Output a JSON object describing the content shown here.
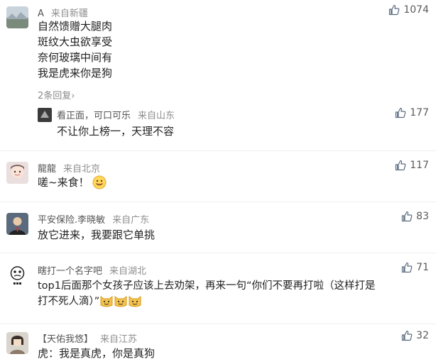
{
  "comments": [
    {
      "user": "A",
      "location": "来自新疆",
      "likes": "1074",
      "lines": [
        "自然馈赠大腿肉",
        "斑纹大虫欲享受",
        "奈何玻璃中间有",
        "我是虎来你是狗"
      ],
      "replies_label": "2条回复",
      "reply": {
        "user": "看正面，可口可乐",
        "location": "来自山东",
        "likes": "177",
        "text": "不让你上榜一，天理不容"
      }
    },
    {
      "user": "龍龍",
      "location": "来自北京",
      "likes": "117",
      "text": "嗟~来食！"
    },
    {
      "user": "平安保险.李晓敏",
      "location": "来自广东",
      "likes": "83",
      "text": "放它进来，我要跟它单挑"
    },
    {
      "user": "瞎打一个名字吧",
      "location": "来自湖北",
      "likes": "71",
      "lines": [
        "top1后面那个女孩子应该上去劝架，再来一句“你们不要再打啦（这样打是",
        "打不死人滴）”"
      ]
    },
    {
      "user": "【天佑我悠】",
      "location": "来自江苏",
      "likes": "32",
      "text": "虎：我是真虎，你是真狗"
    }
  ],
  "icons": {
    "like": "thumbs-up-icon",
    "chevron": "chevron-right-icon",
    "emoji_smile": "smile-emoji",
    "emoji_cat": "cat-emoji"
  },
  "colors": {
    "meta": "#6b6b6b",
    "text": "#222222",
    "divider": "#eeeeee"
  }
}
